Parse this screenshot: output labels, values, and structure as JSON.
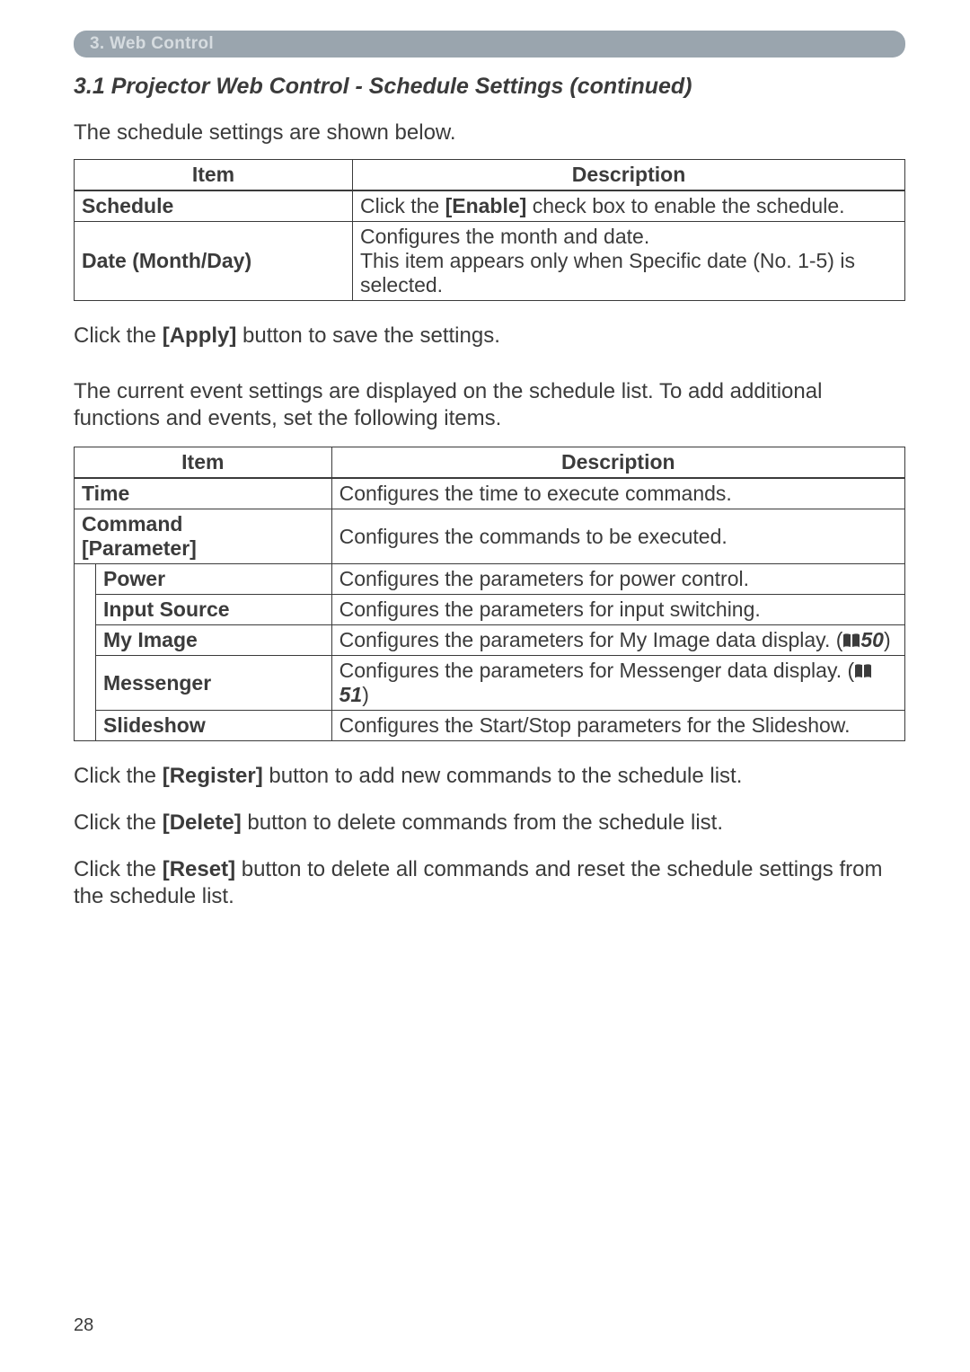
{
  "section_header": "3. Web Control",
  "subheading": "3.1 Projector Web Control - Schedule Settings (continued)",
  "intro1": "The schedule settings are shown below.",
  "table1": {
    "h_item": "Item",
    "h_desc": "Description",
    "r1_item": "Schedule",
    "r1_desc_pre": "Click the ",
    "r1_desc_bold": "[Enable]",
    "r1_desc_post": " check box to enable the schedule.",
    "r2_item": "Date (Month/Day)",
    "r2_desc": "Configures the month and date.\nThis item appears only when Specific date (No. 1-5) is selected."
  },
  "para_apply_pre": "Click the ",
  "para_apply_bold": "[Apply]",
  "para_apply_post": " button to save the settings.",
  "para_current": "The current event settings are displayed on the schedule list. To add additional functions and events, set the following items.",
  "table2": {
    "h_item": "Item",
    "h_desc": "Description",
    "time": "Time",
    "time_desc": "Configures the time to execute commands.",
    "cmd_line1": "Command",
    "cmd_line2": "[Parameter]",
    "cmd_desc": "Configures the commands to be executed.",
    "power": "Power",
    "power_desc": "Configures the parameters for power control.",
    "input": "Input Source",
    "input_desc": "Configures the parameters for input switching.",
    "myimg": "My Image",
    "myimg_desc_pre": "Configures the parameters for My Image data display. (",
    "myimg_ref": "50",
    "myimg_desc_post": ")",
    "msgr": "Messenger",
    "msgr_desc_pre": "Configures the parameters for Messenger data display. (",
    "msgr_ref": "51",
    "msgr_desc_post": ")",
    "slide": "Slideshow",
    "slide_desc": "Configures the Start/Stop parameters for the Slideshow."
  },
  "para_reg_pre": "Click the ",
  "para_reg_bold": "[Register]",
  "para_reg_post": " button to add new commands to the schedule list.",
  "para_del_pre": "Click the ",
  "para_del_bold": "[Delete]",
  "para_del_post": " button to delete commands from the schedule list.",
  "para_reset_pre": "Click the ",
  "para_reset_bold": "[Reset]",
  "para_reset_post": " button to delete all commands and reset the schedule settings from the schedule list.",
  "page_number": "28"
}
